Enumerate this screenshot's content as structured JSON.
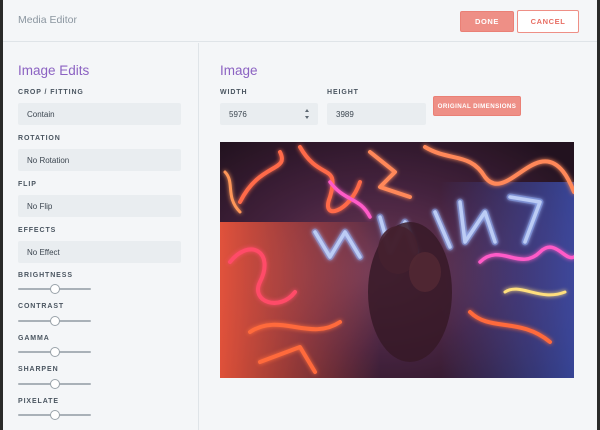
{
  "header": {
    "title": "Media Editor",
    "done_label": "DONE",
    "cancel_label": "CANCEL"
  },
  "sidebar": {
    "heading": "Image Edits",
    "crop": {
      "label": "CROP / FITTING",
      "value": "Contain"
    },
    "rotation": {
      "label": "ROTATION",
      "value": "No Rotation"
    },
    "flip": {
      "label": "FLIP",
      "value": "No Flip"
    },
    "effects": {
      "label": "EFFECTS",
      "value": "No Effect"
    },
    "sliders": [
      {
        "label": "BRIGHTNESS",
        "value": 0.5
      },
      {
        "label": "CONTRAST",
        "value": 0.5
      },
      {
        "label": "GAMMA",
        "value": 0.5
      },
      {
        "label": "SHARPEN",
        "value": 0.5
      },
      {
        "label": "PIXELATE",
        "value": 0.5
      }
    ]
  },
  "main": {
    "heading": "Image",
    "width": {
      "label": "WIDTH",
      "value": "5976"
    },
    "height": {
      "label": "HEIGHT",
      "value": "3989"
    },
    "original_dimensions_label": "ORIGINAL DIMENSIONS",
    "preview_alt": "neon-lights-photo"
  },
  "colors": {
    "accent": "#ee8f86",
    "heading": "#8b62c2",
    "panel": "#f4f6f8",
    "input": "#e9edf0"
  }
}
